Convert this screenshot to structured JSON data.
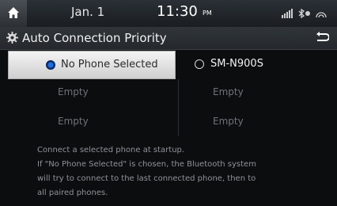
{
  "status": {
    "date": "Jan. 1",
    "time": "11:30",
    "ampm": "PM"
  },
  "header": {
    "title": "Auto Connection Priority"
  },
  "options": [
    {
      "label": "No Phone Selected",
      "selected": true
    },
    {
      "label": "SM-N900S",
      "selected": false
    }
  ],
  "slots": [
    "Empty",
    "Empty",
    "Empty",
    "Empty"
  ],
  "description": {
    "line1": "Connect a selected phone at startup.",
    "line2": "If \"No Phone Selected\" is chosen, the Bluetooth system",
    "line3": "will try to connect to the last connected phone, then to",
    "line4": "all paired phones."
  },
  "icons": [
    "home-icon",
    "signal-icon",
    "bluetooth-icon",
    "settings-gear-icon",
    "back-icon"
  ],
  "colors": {
    "radio_selected": "#1e6fe0",
    "selected_cell": "#e6e6e6"
  }
}
